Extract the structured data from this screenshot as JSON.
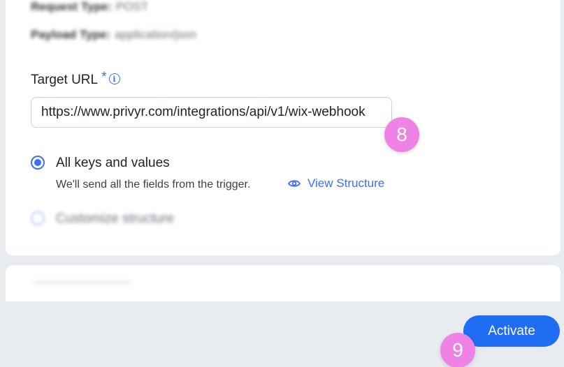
{
  "form": {
    "request_type_label": "Request Type:",
    "request_type_value": "POST",
    "payload_type_label": "Payload Type:",
    "payload_type_value": "application/json",
    "target_url_label": "Target URL",
    "required_marker": "*",
    "target_url_value": "https://www.privyr.com/integrations/api/v1/wix-webhook"
  },
  "structure_options": {
    "all_keys_label": "All keys and values",
    "all_keys_description": "We'll send all the fields from the trigger.",
    "view_structure_link": "View Structure",
    "customize_label": "Customize structure",
    "selected": "All keys and values"
  },
  "footer": {
    "activate_label": "Activate"
  },
  "step_badges": {
    "url_step": "8",
    "activate_step": "9",
    "badge_color": "#ee82e5"
  },
  "colors": {
    "accent": "#3b6ff5",
    "button": "#1f6df2",
    "background": "#e8ebf0"
  },
  "icons": {
    "info": "info-icon",
    "view": "eye-icon"
  }
}
